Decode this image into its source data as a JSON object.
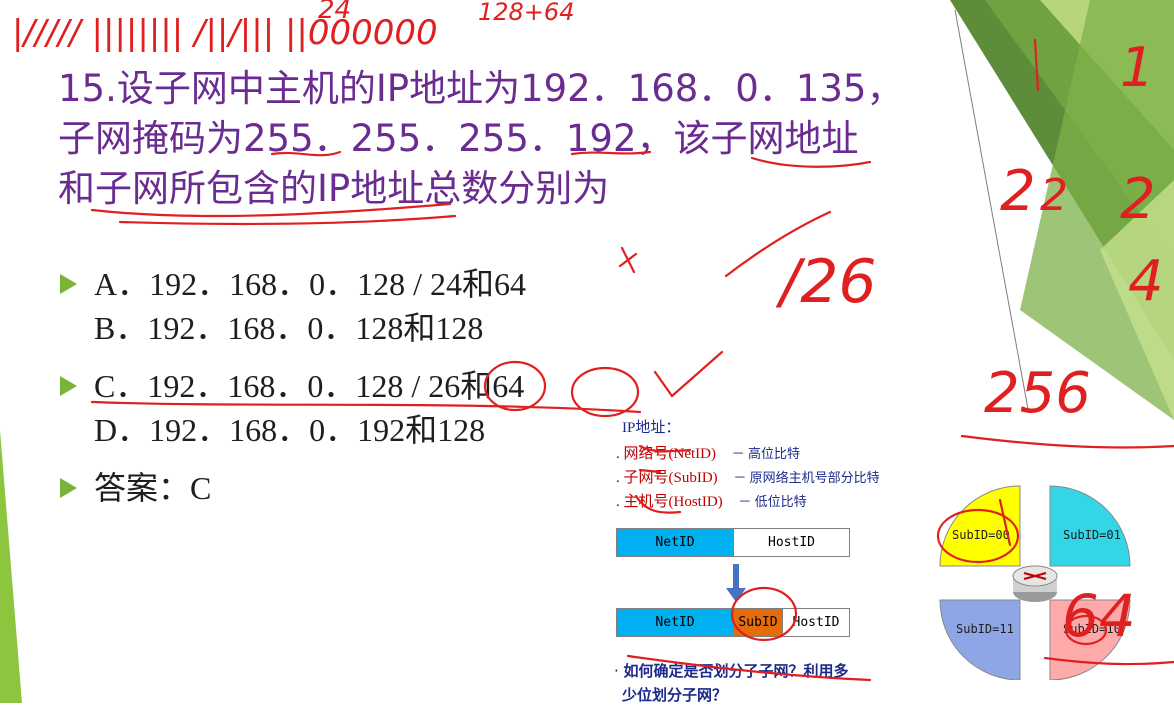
{
  "question": {
    "line1": "15.设子网中主机的IP地址为192．168．0．135，",
    "line2": "子网掩码为255．255．255．192，该子网地址",
    "line3": "和子网所包含的IP地址总数分别为"
  },
  "options": [
    {
      "text": "A．192．168．0．128 / 24和64",
      "bullet": true
    },
    {
      "text": "B．192．168．0．128和128",
      "bullet": false
    },
    {
      "text": "C．192．168．0．128 / 26和64",
      "bullet": true
    },
    {
      "text": "D．192．168．0．192和128",
      "bullet": false
    }
  ],
  "answer": "答案：C",
  "figure": {
    "title": "IP地址：",
    "items": [
      {
        "name": "网络号(NetID)",
        "desc": "－ 高位比特"
      },
      {
        "name": "子网号(SubID)",
        "desc": "－ 原网络主机号部分比特"
      },
      {
        "name": "主机号(HostID)",
        "desc": "－ 低位比特"
      }
    ],
    "bar1": {
      "netid": "NetID",
      "hostid": "HostID"
    },
    "bar2": {
      "netid": "NetID",
      "subid": "SubID",
      "hostid": "HostID"
    },
    "quadrants": [
      "SubID=00",
      "SubID=01",
      "SubID=11",
      "SubID=10"
    ],
    "note_line1": "如何确定是否划分了子网？利用多",
    "note_line2": "少位划分子网？"
  },
  "colors": {
    "question_text": "#6a2c91",
    "bullet": "#7ab338",
    "ink_red": "#e02020",
    "netid_blue": "#00b0f0",
    "subid_orange": "#e46c0a",
    "quad_yellow": "#ffff00",
    "quad_cyan": "#33d6e6",
    "quad_blue": "#8ea6e6",
    "quad_pink": "#ffaaaa"
  },
  "handwriting": {
    "top_marks": "|/////  ||||||||  /||/|||  ||000000",
    "top_num1": "24",
    "top_num2": "128+64",
    "right_col": [
      "1",
      "2",
      "2",
      "2",
      "4"
    ],
    "mid_26": "/26",
    "mid_256": "256",
    "mid_64": "64"
  }
}
